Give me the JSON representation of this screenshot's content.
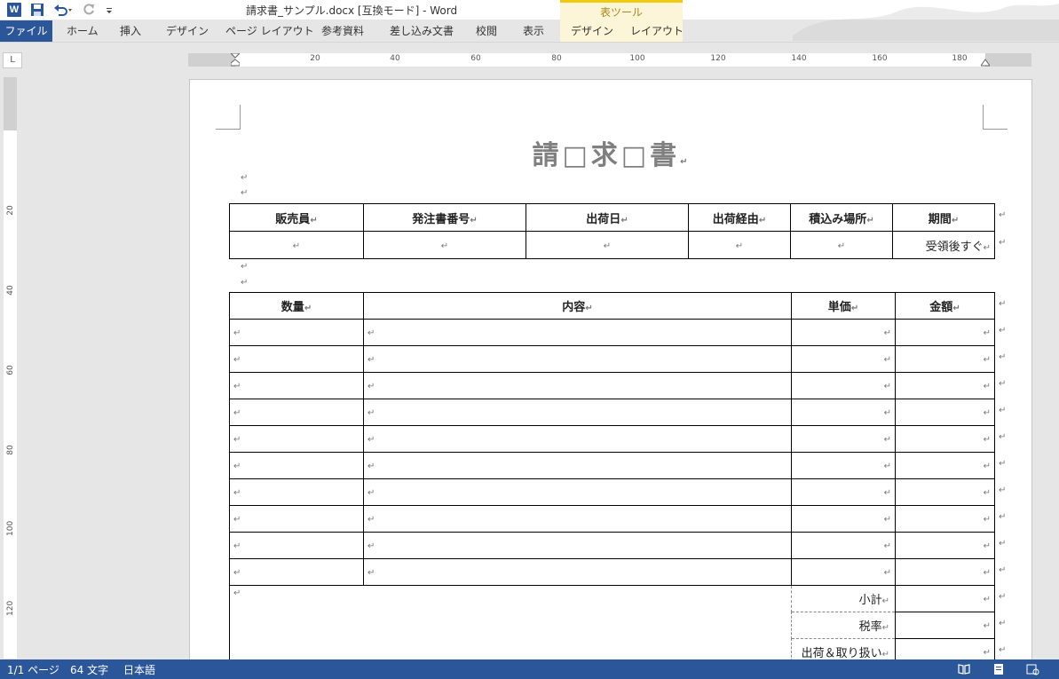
{
  "window": {
    "title": "請求書_サンプル.docx [互換モード] - Word",
    "context_group": "表ツール"
  },
  "quick_access": {
    "icons": [
      "word-logo-icon",
      "save-icon",
      "undo-icon",
      "redo-icon",
      "customize-icon"
    ],
    "logo_letter": "W"
  },
  "ribbon": {
    "tabs": [
      "ファイル",
      "ホーム",
      "挿入",
      "デザイン",
      "ページ レイアウト",
      "参考資料",
      "差し込み文書",
      "校閲",
      "表示",
      "デザイン",
      "レイアウト"
    ]
  },
  "ruler": {
    "corner": "L",
    "horizontal": [
      "20",
      "40",
      "60",
      "80",
      "100",
      "120",
      "140",
      "160",
      "180"
    ],
    "vertical": [
      "20",
      "40",
      "60",
      "80",
      "100",
      "120"
    ]
  },
  "document": {
    "heading": "請□求□書",
    "paragraph_mark": "↵",
    "info_table": {
      "headers": [
        "販売員",
        "発注書番号",
        "出荷日",
        "出荷経由",
        "積込み場所",
        "期間"
      ],
      "row": [
        "",
        "",
        "",
        "",
        "",
        "受領後すぐ"
      ]
    },
    "items_table": {
      "headers": [
        "数量",
        "内容",
        "単価",
        "金額"
      ],
      "row_count": 10
    },
    "totals": [
      "小計",
      "税率",
      "出荷＆取り扱い"
    ]
  },
  "status": {
    "page": "1/1 ページ",
    "words": "64 文字",
    "language": "日本語"
  },
  "colors": {
    "accent": "#2b579a",
    "context_tab": "#fdf5d8",
    "heading": "#7f7f7f"
  }
}
